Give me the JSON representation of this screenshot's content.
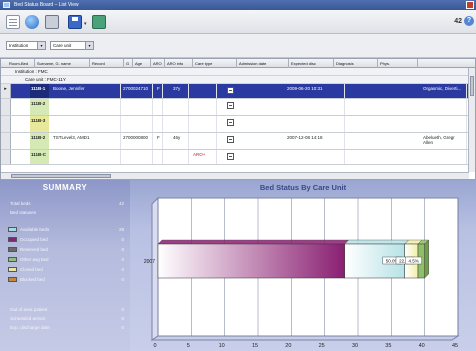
{
  "window": {
    "title": "Bed Status Board – List View"
  },
  "toolbar": {
    "zoom": "42",
    "help_label": "?"
  },
  "filters": {
    "institution_label": "Institution",
    "care_unit_label": "Care unit"
  },
  "columns": [
    "Room-Bed",
    "Surname, G. name",
    "Record",
    "G",
    "Age",
    "ARO",
    "ARO info",
    "Care type",
    "Admission date",
    "Expected disc",
    "Diagnosis",
    "Phys."
  ],
  "group": {
    "institution": "Institution : FMC",
    "care_unit": "Care unit : FMC-11Y"
  },
  "rows": [
    {
      "bed": "111B-1",
      "name": "Boone, Jennifer",
      "record": "2700024710",
      "g": "F",
      "age": "37y",
      "aro": "",
      "admission": "2009-06-20 10:31",
      "diagnosis": "Orgasmic, Diverti...",
      "color": "#1c2a7a",
      "selected": true
    },
    {
      "bed": "111B-2",
      "name": "",
      "record": "",
      "g": "",
      "age": "",
      "aro": "",
      "admission": "",
      "diagnosis": "",
      "color": "#d4e9b4",
      "selected": false
    },
    {
      "bed": "111B-3",
      "name": "",
      "record": "",
      "g": "",
      "age": "",
      "aro": "",
      "admission": "",
      "diagnosis": "",
      "color": "#e8e89a",
      "selected": false
    },
    {
      "bed": "111B-2",
      "name": "TSTLevel3, AMD1",
      "record": "2700000800",
      "g": "F",
      "age": "46y",
      "aro": "",
      "admission": "2007-12-08 14:18",
      "diagnosis": "Abelueth, Gregr Allen",
      "color": "#d4e9b4",
      "selected": false
    },
    {
      "bed": "111B-C",
      "name": "",
      "record": "",
      "g": "",
      "age": "",
      "aro": "ARO+",
      "admission": "",
      "diagnosis": "",
      "color": "#d4e9b4",
      "selected": false
    }
  ],
  "summary": {
    "title": "SUMMARY",
    "top": [
      {
        "label": "Total beds",
        "value": "42"
      },
      {
        "label": "Bed statuses",
        "value": ""
      }
    ],
    "statuses": [
      {
        "label": "Available beds",
        "value": "28",
        "color": "#a7d8de"
      },
      {
        "label": "Occupied bed",
        "value": "0",
        "color": "#7a2a6e"
      },
      {
        "label": "Reserved bed",
        "value": "0",
        "color": "#6a6a6a"
      },
      {
        "label": "Other avg bed",
        "value": "0",
        "color": "#8bbf7a"
      },
      {
        "label": "Closed bed",
        "value": "0",
        "color": "#e8e4a0"
      },
      {
        "label": "Blocked bed",
        "value": "0",
        "color": "#c9873e"
      }
    ],
    "bottom": [
      {
        "label": "Out of area patient",
        "value": "0"
      },
      {
        "label": "Scheduled arrival",
        "value": "0"
      },
      {
        "label": "Exp. discharge date",
        "value": "0"
      }
    ]
  },
  "chart_data": {
    "type": "bar",
    "orientation": "horizontal",
    "stacked": true,
    "title": "Bed Status By Care Unit",
    "categories": [
      "2007"
    ],
    "xlim": [
      0,
      45
    ],
    "xticks": [
      0,
      5,
      10,
      15,
      20,
      25,
      30,
      35,
      40,
      45
    ],
    "segments": [
      {
        "value": 28,
        "color": "#8a1f72",
        "label": ""
      },
      {
        "value": 9,
        "color": "#b7e2e6",
        "label": "50.0%"
      },
      {
        "value": 2,
        "color": "#f2eea9",
        "label": "22.4%"
      },
      {
        "value": 1,
        "color": "#8fbf6b",
        "label": "4.5%"
      }
    ]
  }
}
